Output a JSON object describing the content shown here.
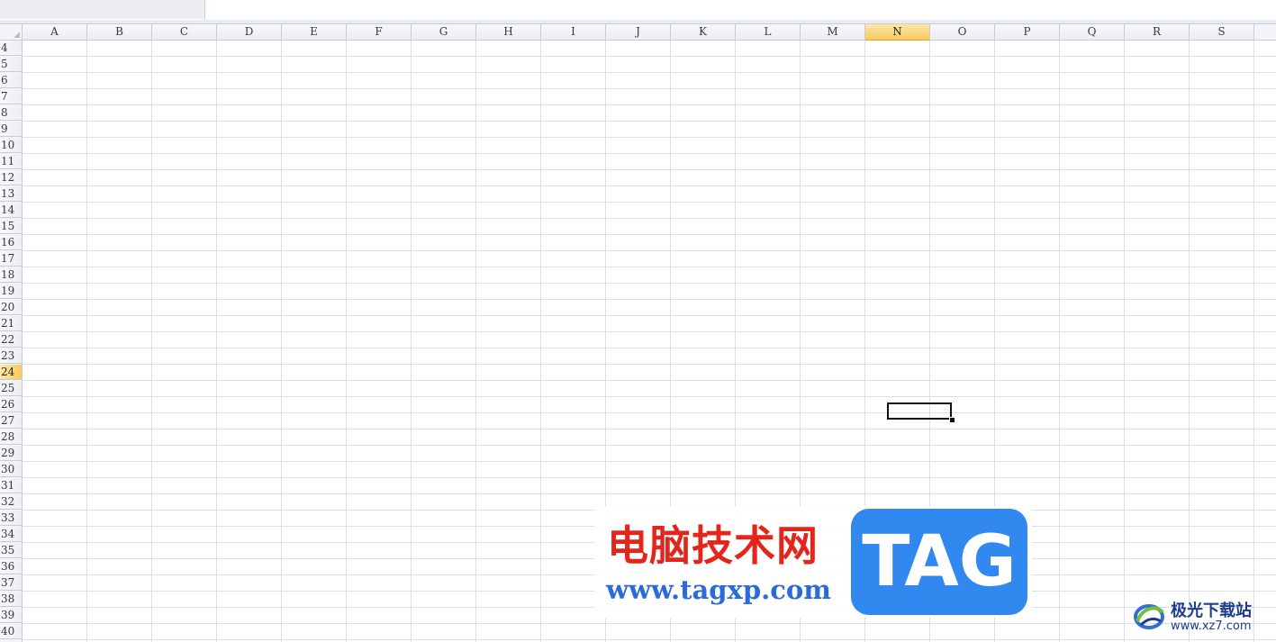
{
  "spreadsheet": {
    "columns": [
      "A",
      "B",
      "C",
      "D",
      "E",
      "F",
      "G",
      "H",
      "I",
      "J",
      "K",
      "L",
      "M",
      "N",
      "O",
      "P",
      "Q",
      "R",
      "S"
    ],
    "rows": [
      "4",
      "5",
      "6",
      "7",
      "8",
      "9",
      "10",
      "11",
      "12",
      "13",
      "14",
      "15",
      "16",
      "17",
      "18",
      "19",
      "20",
      "21",
      "22",
      "23",
      "24",
      "25",
      "26",
      "27",
      "28",
      "29",
      "30",
      "31",
      "32",
      "33",
      "34",
      "35",
      "36",
      "37",
      "38",
      "39",
      "40"
    ],
    "selected_column": "N",
    "selected_row": "24",
    "colors": {
      "header_bg": "#f2f4f7",
      "selected_header": "#f7c95b",
      "gridline": "#dbe0e6"
    }
  },
  "watermark": {
    "title": "电脑技术网",
    "url": "www.tagxp.com",
    "tag": "TAG",
    "colors": {
      "title": "#e3261b",
      "url": "#2b6bd6",
      "tag_bg": "#3189ef"
    }
  },
  "corner_logo": {
    "name": "极光下载站",
    "url": "www.xz7.com",
    "icon": "aurora-swirl-icon"
  }
}
